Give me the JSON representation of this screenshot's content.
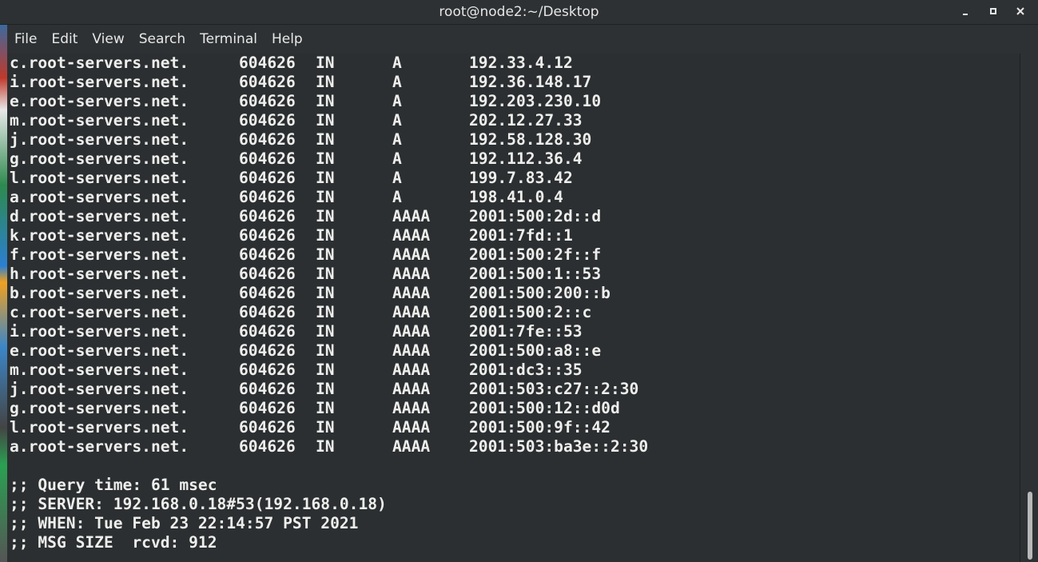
{
  "window": {
    "title": "root@node2:~/Desktop",
    "controls": [
      "minimize",
      "maximize",
      "close"
    ]
  },
  "menubar": {
    "items": [
      "File",
      "Edit",
      "View",
      "Search",
      "Terminal",
      "Help"
    ]
  },
  "terminal": {
    "records": [
      {
        "name": "c.root-servers.net.",
        "ttl": "604626",
        "class": "IN",
        "type": "A",
        "data": "192.33.4.12"
      },
      {
        "name": "i.root-servers.net.",
        "ttl": "604626",
        "class": "IN",
        "type": "A",
        "data": "192.36.148.17"
      },
      {
        "name": "e.root-servers.net.",
        "ttl": "604626",
        "class": "IN",
        "type": "A",
        "data": "192.203.230.10"
      },
      {
        "name": "m.root-servers.net.",
        "ttl": "604626",
        "class": "IN",
        "type": "A",
        "data": "202.12.27.33"
      },
      {
        "name": "j.root-servers.net.",
        "ttl": "604626",
        "class": "IN",
        "type": "A",
        "data": "192.58.128.30"
      },
      {
        "name": "g.root-servers.net.",
        "ttl": "604626",
        "class": "IN",
        "type": "A",
        "data": "192.112.36.4"
      },
      {
        "name": "l.root-servers.net.",
        "ttl": "604626",
        "class": "IN",
        "type": "A",
        "data": "199.7.83.42"
      },
      {
        "name": "a.root-servers.net.",
        "ttl": "604626",
        "class": "IN",
        "type": "A",
        "data": "198.41.0.4"
      },
      {
        "name": "d.root-servers.net.",
        "ttl": "604626",
        "class": "IN",
        "type": "AAAA",
        "data": "2001:500:2d::d"
      },
      {
        "name": "k.root-servers.net.",
        "ttl": "604626",
        "class": "IN",
        "type": "AAAA",
        "data": "2001:7fd::1"
      },
      {
        "name": "f.root-servers.net.",
        "ttl": "604626",
        "class": "IN",
        "type": "AAAA",
        "data": "2001:500:2f::f"
      },
      {
        "name": "h.root-servers.net.",
        "ttl": "604626",
        "class": "IN",
        "type": "AAAA",
        "data": "2001:500:1::53"
      },
      {
        "name": "b.root-servers.net.",
        "ttl": "604626",
        "class": "IN",
        "type": "AAAA",
        "data": "2001:500:200::b"
      },
      {
        "name": "c.root-servers.net.",
        "ttl": "604626",
        "class": "IN",
        "type": "AAAA",
        "data": "2001:500:2::c"
      },
      {
        "name": "i.root-servers.net.",
        "ttl": "604626",
        "class": "IN",
        "type": "AAAA",
        "data": "2001:7fe::53"
      },
      {
        "name": "e.root-servers.net.",
        "ttl": "604626",
        "class": "IN",
        "type": "AAAA",
        "data": "2001:500:a8::e"
      },
      {
        "name": "m.root-servers.net.",
        "ttl": "604626",
        "class": "IN",
        "type": "AAAA",
        "data": "2001:dc3::35"
      },
      {
        "name": "j.root-servers.net.",
        "ttl": "604626",
        "class": "IN",
        "type": "AAAA",
        "data": "2001:503:c27::2:30"
      },
      {
        "name": "g.root-servers.net.",
        "ttl": "604626",
        "class": "IN",
        "type": "AAAA",
        "data": "2001:500:12::d0d"
      },
      {
        "name": "l.root-servers.net.",
        "ttl": "604626",
        "class": "IN",
        "type": "AAAA",
        "data": "2001:500:9f::42"
      },
      {
        "name": "a.root-servers.net.",
        "ttl": "604626",
        "class": "IN",
        "type": "AAAA",
        "data": "2001:503:ba3e::2:30"
      }
    ],
    "footer": [
      ";; Query time: 61 msec",
      ";; SERVER: 192.168.0.18#53(192.168.0.18)",
      ";; WHEN: Tue Feb 23 22:14:57 PST 2021",
      ";; MSG SIZE  rcvd: 912"
    ]
  },
  "colors": {
    "background": "#2b2f31",
    "text": "#eeeeec",
    "chrome": "#2d3133"
  }
}
